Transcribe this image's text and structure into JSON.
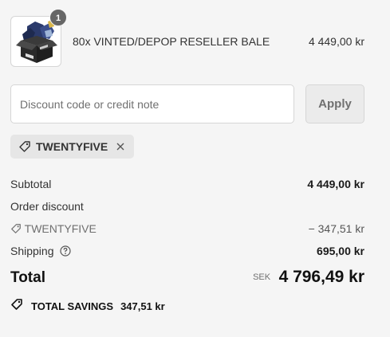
{
  "product": {
    "quantity_badge": "1",
    "name": "80x VINTED/DEPOP RESELLER BALE",
    "price": "4 449,00 kr",
    "image_icon": "clothing-bale-box-image"
  },
  "discount": {
    "placeholder": "Discount code or credit note",
    "apply_label": "Apply",
    "applied_code": "TWENTYFIVE"
  },
  "summary": {
    "subtotal_label": "Subtotal",
    "subtotal_value": "4 449,00 kr",
    "order_discount_label": "Order discount",
    "discount_code": "TWENTYFIVE",
    "discount_value": "− 347,51 kr",
    "shipping_label": "Shipping",
    "shipping_value": "695,00 kr",
    "total_label": "Total",
    "total_currency": "SEK",
    "total_value": "4 796,49 kr",
    "savings_label": "TOTAL SAVINGS",
    "savings_value": "347,51 kr"
  },
  "colors": {
    "background": "#f5f5f5",
    "text": "#333333",
    "muted": "#707070",
    "border": "#d6d6d6",
    "tag_bg": "#e6e6e6",
    "badge_bg": "#666666"
  }
}
